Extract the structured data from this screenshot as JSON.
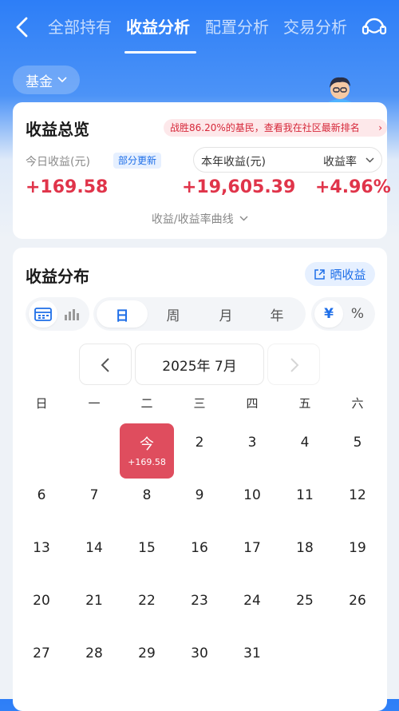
{
  "header": {
    "tabs": [
      {
        "label": "全部持有",
        "active": false
      },
      {
        "label": "收益分析",
        "active": true
      },
      {
        "label": "配置分析",
        "active": false
      },
      {
        "label": "交易分析",
        "active": false
      }
    ]
  },
  "filter": {
    "label": "基金"
  },
  "overview": {
    "title": "收益总览",
    "promo": "战胜86.20%的基民，查看我在社区最新排名",
    "today_label": "今日收益(元)",
    "today_tag": "部分更新",
    "today_value": "+169.58",
    "year_label": "本年收益(元)",
    "year_value": "+19,605.39",
    "rate_label": "收益率",
    "rate_value": "+4.96%",
    "curve_link": "收益/收益率曲线"
  },
  "distribution": {
    "title": "收益分布",
    "share_label": "晒收益",
    "periods": [
      "日",
      "周",
      "月",
      "年"
    ],
    "active_period": "日",
    "units": [
      "¥",
      "%"
    ],
    "active_unit": "¥",
    "month": "2025年 7月",
    "weekdays": [
      "日",
      "一",
      "二",
      "三",
      "四",
      "五",
      "六"
    ],
    "today": {
      "label": "今",
      "profit": "+169.58"
    },
    "days": [
      "2",
      "3",
      "4",
      "5",
      "6",
      "7",
      "8",
      "9",
      "10",
      "11",
      "12",
      "13",
      "14",
      "15",
      "16",
      "17",
      "18",
      "19",
      "20",
      "21",
      "22",
      "23",
      "24",
      "25",
      "26",
      "27",
      "28",
      "29",
      "30",
      "31"
    ]
  },
  "colors": {
    "accent": "#1f6fe8",
    "profit": "#e0344a",
    "today_bg": "#df4d5e",
    "header_blue": "#2d7ef7"
  }
}
